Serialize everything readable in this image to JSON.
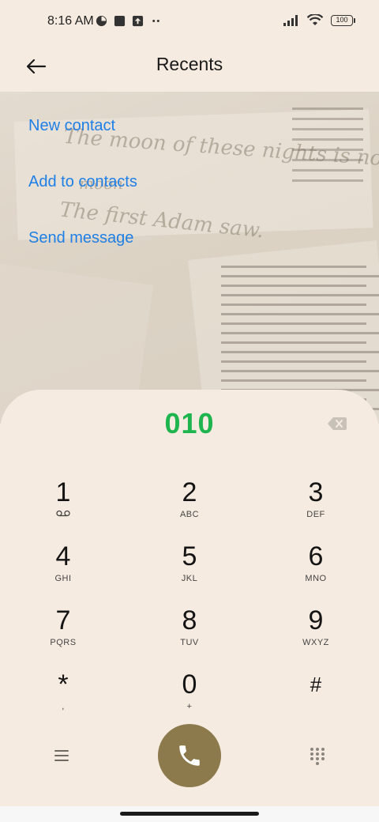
{
  "status_bar": {
    "time": "8:16 AM",
    "battery": "100",
    "icons": [
      "alarm-icon",
      "square-icon",
      "upload-icon",
      "dots-icon",
      "signal-icon",
      "wifi-icon",
      "battery-icon"
    ]
  },
  "header": {
    "title": "Recents",
    "back_icon": "arrow-left-icon"
  },
  "actions": {
    "new_contact": "New contact",
    "add_to_contacts": "Add to contacts",
    "send_message": "Send message"
  },
  "wallpaper_text": {
    "line1": "The moon of these nights is not the",
    "line2": "moon",
    "line3": "The first Adam saw."
  },
  "dialer": {
    "entered_number": "010",
    "number_color": "#1eb54f",
    "keys": [
      {
        "digit": "1",
        "letters": "voicemail-icon"
      },
      {
        "digit": "2",
        "letters": "ABC"
      },
      {
        "digit": "3",
        "letters": "DEF"
      },
      {
        "digit": "4",
        "letters": "GHI"
      },
      {
        "digit": "5",
        "letters": "JKL"
      },
      {
        "digit": "6",
        "letters": "MNO"
      },
      {
        "digit": "7",
        "letters": "PQRS"
      },
      {
        "digit": "8",
        "letters": "TUV"
      },
      {
        "digit": "9",
        "letters": "WXYZ"
      },
      {
        "digit": "*",
        "letters": ","
      },
      {
        "digit": "0",
        "letters": "+"
      },
      {
        "digit": "#",
        "letters": ""
      }
    ],
    "call_button_color": "#8c7a4c"
  },
  "colors": {
    "background": "#f6ebe0",
    "link": "#1e7fe6"
  }
}
